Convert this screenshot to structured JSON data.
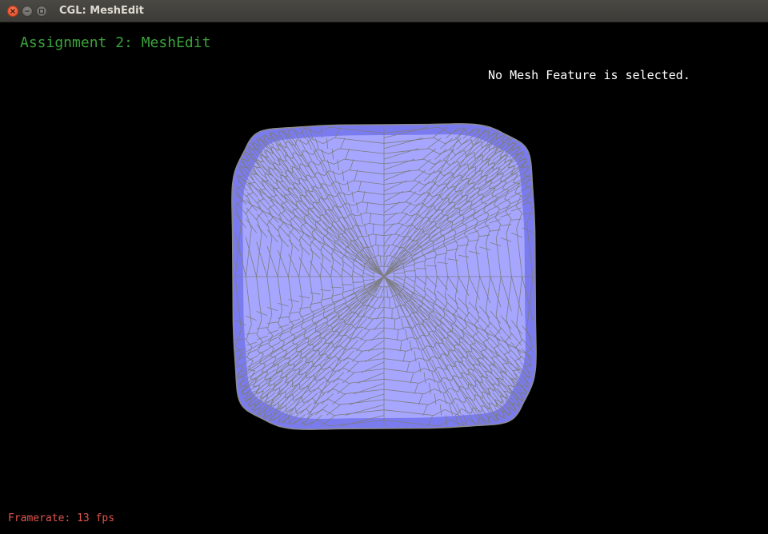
{
  "window": {
    "title": "CGL: MeshEdit",
    "close_icon": "close-icon",
    "minimize_icon": "minimize-icon",
    "maximize_icon": "maximize-icon"
  },
  "viewport": {
    "heading": "Assignment 2: MeshEdit",
    "status": "No Mesh Feature is selected.",
    "framerate": "Framerate: 13 fps"
  },
  "colors": {
    "background": "#000000",
    "heading": "#3aa23a",
    "status": "#ffffff",
    "framerate": "#e0554e",
    "mesh_fill": "#a6a6ff",
    "mesh_edge_fill": "#7b7bf0",
    "mesh_wire": "#808080"
  }
}
